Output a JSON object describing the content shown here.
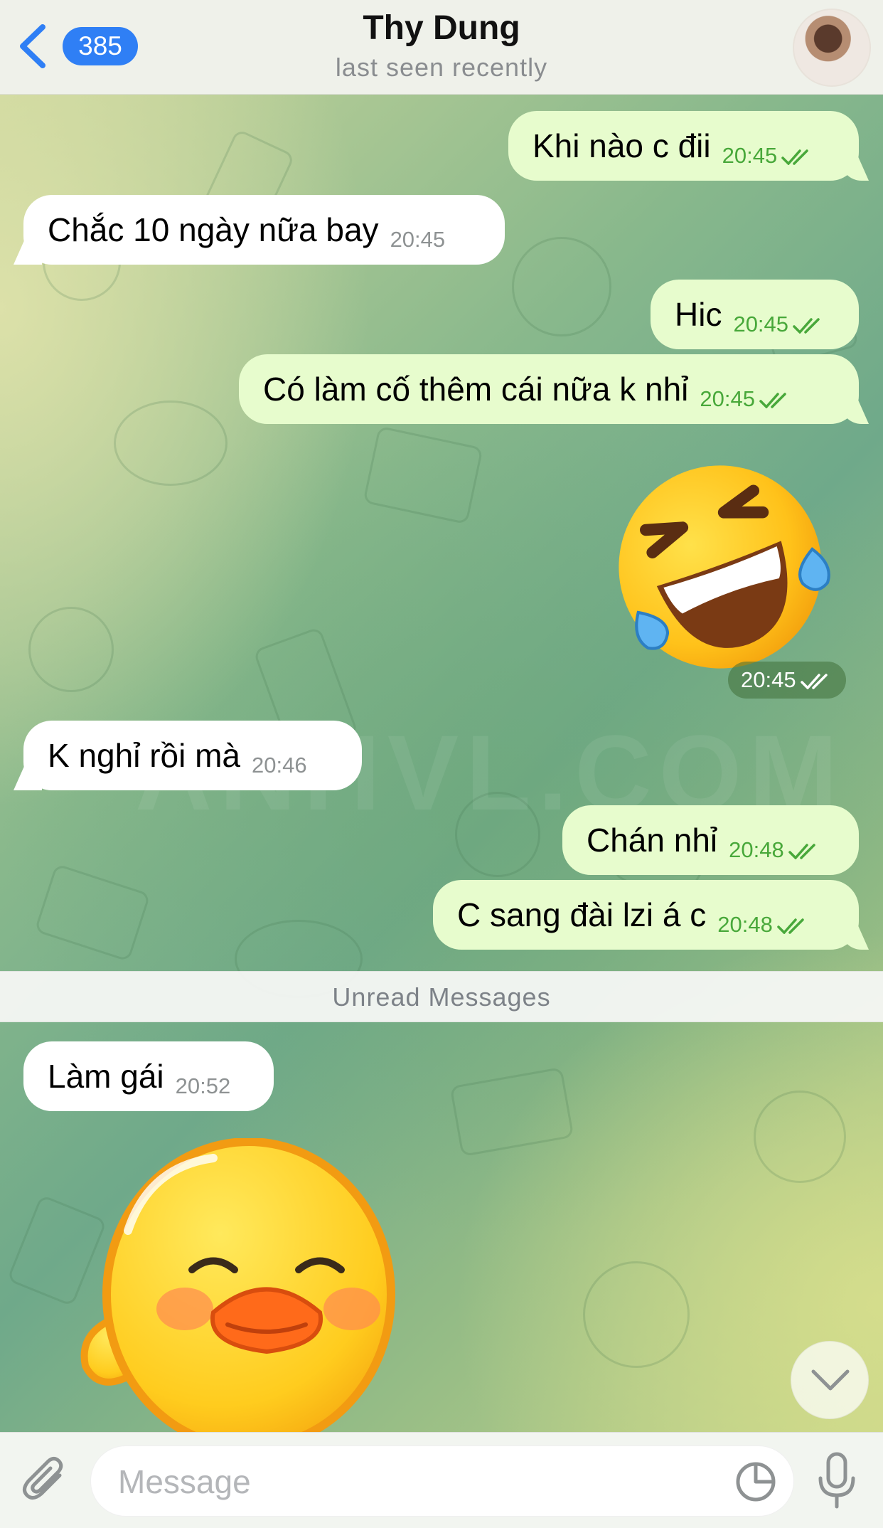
{
  "header": {
    "back_count": "385",
    "title": "Thy Dung",
    "status": "last seen recently"
  },
  "messages": [
    {
      "direction": "out",
      "text": "Khi nào c đii",
      "time": "20:45",
      "read": true
    },
    {
      "direction": "in",
      "text": "Chắc 10 ngày nữa bay",
      "time": "20:45"
    },
    {
      "direction": "out",
      "text": "Hic",
      "time": "20:45",
      "read": true
    },
    {
      "direction": "out",
      "text": "Có làm cố thêm cái nữa k nhỉ",
      "time": "20:45",
      "read": true
    },
    {
      "direction": "out",
      "type": "sticker",
      "sticker": "rolling-on-floor-laughing-emoji",
      "time": "20:45",
      "read": true
    },
    {
      "direction": "in",
      "text": "K nghỉ rồi mà",
      "time": "20:46"
    },
    {
      "direction": "out",
      "text": "Chán nhỉ",
      "time": "20:48",
      "read": true
    },
    {
      "direction": "out",
      "text": "C sang đài lzi á c",
      "time": "20:48",
      "read": true
    },
    {
      "direction": "in",
      "text": "Làm gái",
      "time": "20:52"
    },
    {
      "direction": "in",
      "type": "sticker",
      "sticker": "waving-duck-sticker"
    }
  ],
  "watermark": "ANHVL.COM",
  "unread_label": "Unread Messages",
  "input": {
    "placeholder": "Message",
    "value": ""
  },
  "icons": [
    "chevron-left-icon",
    "paperclip-icon",
    "sticker-icon",
    "microphone-icon",
    "chevron-down-icon",
    "double-check-icon"
  ],
  "colors": {
    "outgoing_bubble": "#e7fccd",
    "incoming_bubble": "#ffffff",
    "accent": "#2f7ff5",
    "read_tick": "#48a83a"
  }
}
